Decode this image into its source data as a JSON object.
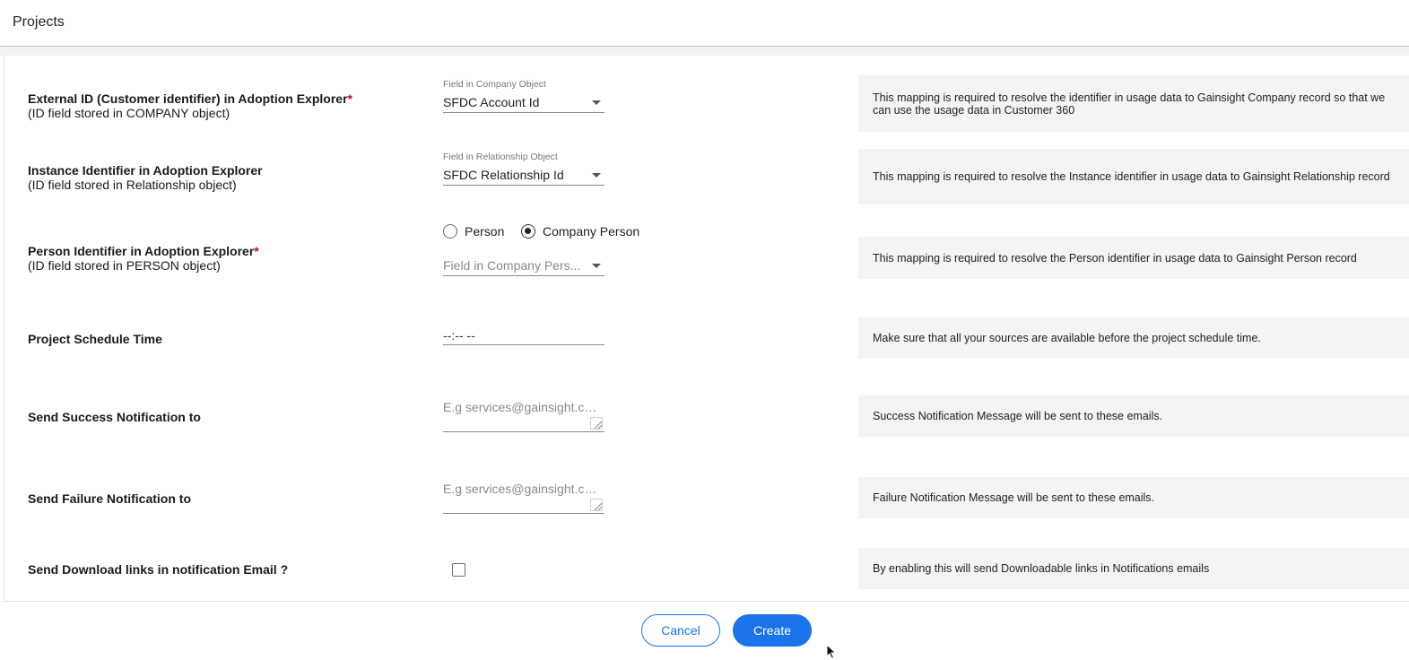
{
  "header": {
    "title": "Projects"
  },
  "rows": {
    "external_id": {
      "label": "External ID (Customer identifier) in Adoption Explorer",
      "required_mark": "*",
      "sublabel": "(ID field stored in COMPANY object)",
      "field_caption": "Field in Company Object",
      "field_value": "SFDC Account Id",
      "help": "This mapping is required to resolve the identifier in usage data to Gainsight Company record so that we can use the usage data in Customer 360"
    },
    "instance_id": {
      "label": "Instance Identifier in Adoption Explorer",
      "sublabel": "(ID field stored in Relationship object)",
      "field_caption": "Field in Relationship Object",
      "field_value": "SFDC Relationship Id",
      "help": "This mapping is required to resolve the Instance identifier in usage data to Gainsight Relationship record"
    },
    "person_id": {
      "label": "Person Identifier in Adoption Explorer",
      "required_mark": "*",
      "sublabel": "(ID field stored in PERSON object)",
      "radio_person": "Person",
      "radio_company_person": "Company Person",
      "selected_radio": "Company Person",
      "field_placeholder": "Field in Company Pers...",
      "help": "This mapping is required to resolve the Person identifier in usage data to Gainsight Person record"
    },
    "schedule": {
      "label": "Project Schedule Time",
      "time_value": "--:-- --",
      "help": "Make sure that all your sources are available before the project schedule time."
    },
    "success": {
      "label": "Send Success Notification to",
      "placeholder": "E.g services@gainsight.co...",
      "help": "Success Notification Message will be sent to these emails."
    },
    "failure": {
      "label": "Send Failure Notification to",
      "placeholder": "E.g services@gainsight.co...",
      "help": "Failure Notification Message will be sent to these emails."
    },
    "download_links": {
      "label": "Send Download links in notification Email ?",
      "checked": false,
      "help": "By enabling this will send Downloadable links in Notifications emails"
    }
  },
  "footer": {
    "cancel_label": "Cancel",
    "create_label": "Create"
  },
  "colors": {
    "primary": "#1a73e8",
    "required": "#d0021b",
    "help_bg": "#f4f4f4"
  }
}
